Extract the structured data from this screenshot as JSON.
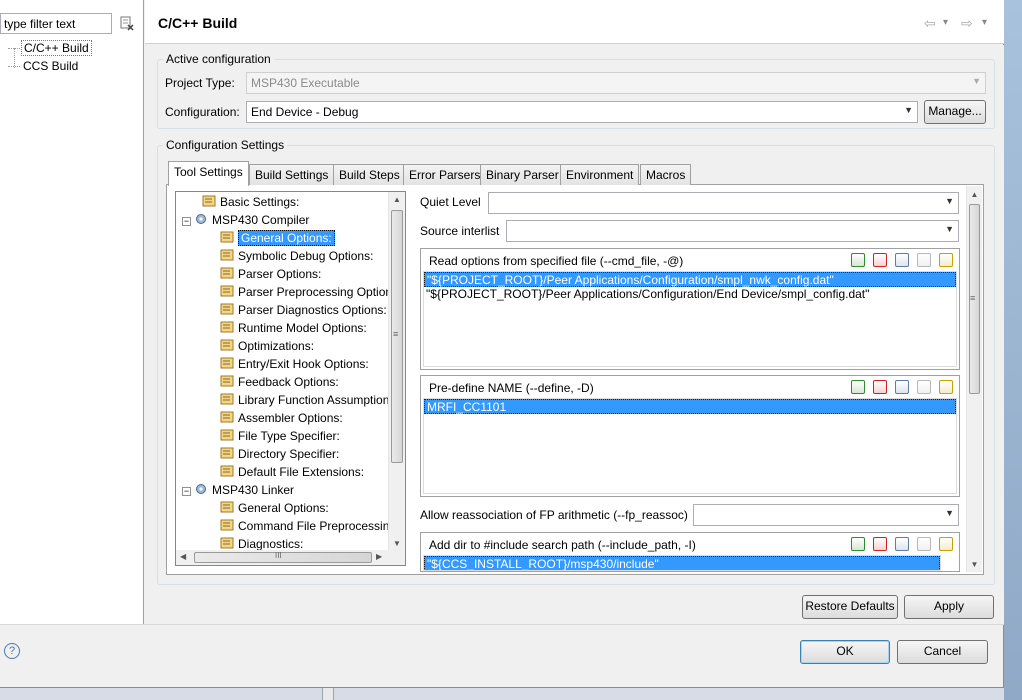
{
  "left": {
    "filter_value": "type filter text",
    "tree": [
      {
        "label": "C/C++ Build",
        "selected": true
      },
      {
        "label": "CCS Build",
        "selected": false
      }
    ],
    "help_glyph": "?"
  },
  "header": {
    "title": "C/C++ Build",
    "nav_back": "⇦",
    "nav_forward": "⇨",
    "nav_menu": "▾"
  },
  "active_config": {
    "group_label": "Active configuration",
    "project_type_label": "Project Type:",
    "project_type_value": "MSP430 Executable",
    "configuration_label": "Configuration:",
    "configuration_value": "End Device - Debug",
    "manage_button": "Manage..."
  },
  "config_settings": {
    "group_label": "Configuration Settings",
    "tabs": [
      "Tool Settings",
      "Build Settings",
      "Build Steps",
      "Error Parsers",
      "Binary Parser",
      "Environment",
      "Macros"
    ],
    "active_tab": "Tool Settings"
  },
  "tree": {
    "items": [
      {
        "label": "Basic Settings:",
        "level": 1
      },
      {
        "label": "MSP430 Compiler",
        "level": 0,
        "expanded": true
      },
      {
        "label": "General Options:",
        "level": 2,
        "selected": true
      },
      {
        "label": "Symbolic Debug Options:",
        "level": 2
      },
      {
        "label": "Parser Options:",
        "level": 2
      },
      {
        "label": "Parser Preprocessing Option",
        "level": 2
      },
      {
        "label": "Parser Diagnostics Options:",
        "level": 2
      },
      {
        "label": "Runtime Model Options:",
        "level": 2
      },
      {
        "label": "Optimizations:",
        "level": 2
      },
      {
        "label": "Entry/Exit Hook Options:",
        "level": 2
      },
      {
        "label": "Feedback Options:",
        "level": 2
      },
      {
        "label": "Library Function Assumption",
        "level": 2
      },
      {
        "label": "Assembler Options:",
        "level": 2
      },
      {
        "label": "File Type Specifier:",
        "level": 2
      },
      {
        "label": "Directory Specifier:",
        "level": 2
      },
      {
        "label": "Default File Extensions:",
        "level": 2
      },
      {
        "label": "MSP430 Linker",
        "level": 0,
        "expanded": true
      },
      {
        "label": "General Options:",
        "level": 2
      },
      {
        "label": "Command File Preprocessin",
        "level": 2
      },
      {
        "label": "Diagnostics:",
        "level": 2
      }
    ],
    "hscroll_grip": "III",
    "vscroll_grip": "≡"
  },
  "options": {
    "quiet_level_label": "Quiet Level",
    "quiet_level_value": "",
    "source_interlist_label": "Source interlist",
    "source_interlist_value": "",
    "cmd_file_title": "Read options from specified file (--cmd_file, -@)",
    "cmd_file_items": [
      "\"${PROJECT_ROOT}/Peer Applications/Configuration/smpl_nwk_config.dat\"",
      "\"${PROJECT_ROOT}/Peer Applications/Configuration/End Device/smpl_config.dat\""
    ],
    "define_title": "Pre-define NAME (--define, -D)",
    "define_items": [
      "MRFI_CC1101"
    ],
    "fp_reassoc_label": "Allow reassociation of FP arithmetic (--fp_reassoc)",
    "fp_reassoc_value": "",
    "include_title": "Add dir to #include search path (--include_path, -I)",
    "include_items": [
      "\"${CCS_INSTALL_ROOT}/msp430/include\""
    ],
    "panel_vscroll_grip": "≡"
  },
  "buttons": {
    "restore_defaults": "Restore Defaults",
    "apply": "Apply",
    "ok": "OK",
    "cancel": "Cancel"
  },
  "icon_colors": {
    "add": "#2e8b2e",
    "delete": "#cc2222",
    "edit": "#5a7ca8",
    "move": "#c8a000"
  }
}
